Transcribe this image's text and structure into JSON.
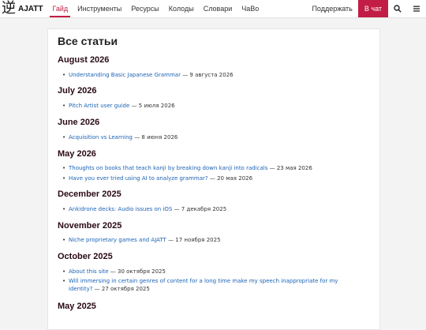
{
  "nav": {
    "logo_glyph": "逆",
    "logo_text": "AJATT",
    "links": [
      "Гайд",
      "Инструменты",
      "Ресурсы",
      "Колоды",
      "Словари",
      "ЧаВо"
    ],
    "support": "Поддержать",
    "chat": "В чат",
    "accent_color": "#c21d45"
  },
  "page": {
    "title": "Все статьи",
    "sections": [
      {
        "month": "August 2026",
        "entries": [
          {
            "title": "Understanding Basic Japanese Grammar",
            "date": "— 9 августа 2026"
          }
        ]
      },
      {
        "month": "July 2026",
        "entries": [
          {
            "title": "Pitch Artist user guide",
            "date": "— 5 июля 2026"
          }
        ]
      },
      {
        "month": "June 2026",
        "entries": [
          {
            "title": "Acquisition vs Learning",
            "date": "— 8 июня 2026"
          }
        ]
      },
      {
        "month": "May 2026",
        "entries": [
          {
            "title": "Thoughts on books that teach kanji by breaking down kanji into radicals",
            "date": "— 23 мая 2026"
          },
          {
            "title": "Have you ever tried using AI to analyze grammar?",
            "date": "— 20 мая 2026"
          }
        ]
      },
      {
        "month": "December 2025",
        "entries": [
          {
            "title": "Ankidrone decks: Audio issues on iOS",
            "date": "— 7 декабря 2025"
          }
        ]
      },
      {
        "month": "November 2025",
        "entries": [
          {
            "title": "Niche proprietary games and AJATT",
            "date": "— 17 ноября 2025"
          }
        ]
      },
      {
        "month": "October 2025",
        "entries": [
          {
            "title": "About this site",
            "date": "— 30 октября 2025"
          },
          {
            "title": "Will immersing in certain genres of content for a long time make my speech inappropriate for my identity?",
            "date": "— 27 октября 2025"
          }
        ]
      },
      {
        "month": "May 2025",
        "entries": []
      }
    ]
  }
}
